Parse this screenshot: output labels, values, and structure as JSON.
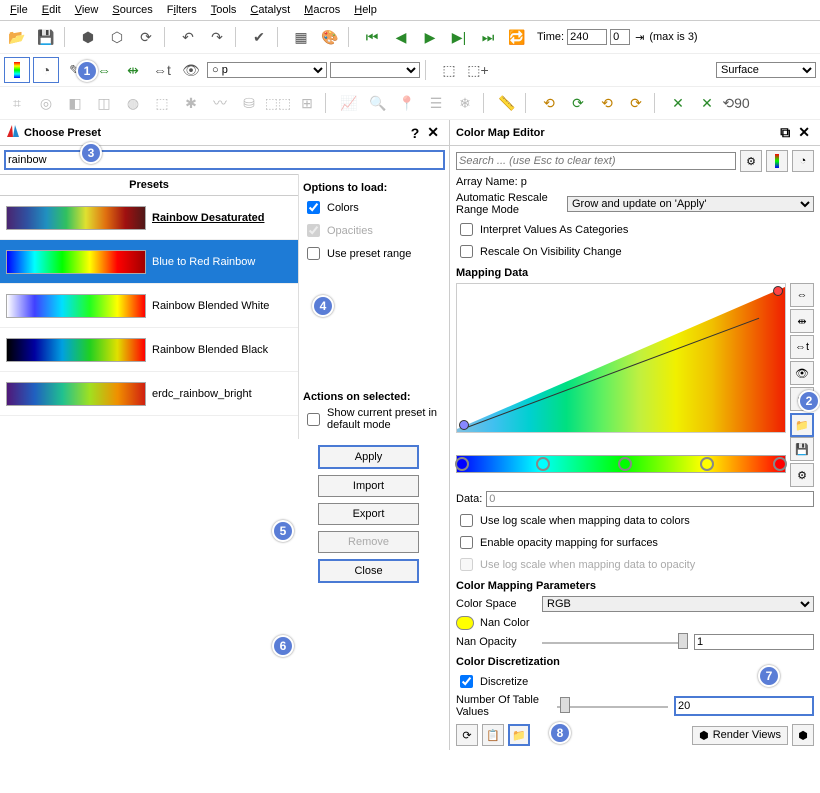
{
  "menu": [
    "File",
    "Edit",
    "View",
    "Sources",
    "Filters",
    "Tools",
    "Catalyst",
    "Macros",
    "Help"
  ],
  "time": {
    "label": "Time:",
    "value": "240",
    "step": "0",
    "max_text": "(max is 3)"
  },
  "array_combo": "○ p",
  "repr_combo": "Surface",
  "choose_preset": {
    "title": "Choose Preset",
    "search": "rainbow",
    "presets_header": "Presets",
    "items": [
      {
        "name": "Rainbow Desaturated",
        "bold": true,
        "grad": "linear-gradient(to right,#4a2570,#3050a0,#2090c0,#30c060,#e0e030,#e07010,#a01010,#501818)"
      },
      {
        "name": "Blue to Red Rainbow",
        "bold": false,
        "grad": "linear-gradient(to right,#0000ff,#00ffff,#00ff00,#ffff00,#ff0000,#a00000)",
        "selected": true
      },
      {
        "name": "Rainbow Blended White",
        "bold": false,
        "grad": "linear-gradient(to right,#ffffff,#4040ff,#00e0ff,#20ff20,#ffff00,#ff0000)"
      },
      {
        "name": "Rainbow Blended Black",
        "bold": false,
        "grad": "linear-gradient(to right,#000000,#0000a0,#00a0e0,#20d020,#e0e000,#ff0000)"
      },
      {
        "name": "erdc_rainbow_bright",
        "bold": false,
        "grad": "linear-gradient(to right,#501878,#2060c0,#20c090,#a0e020,#f09000,#d02010)"
      }
    ],
    "opts_header": "Options to load:",
    "opt_colors": "Colors",
    "opt_opacities": "Opacities",
    "opt_range": "Use preset range",
    "actions_header": "Actions on selected:",
    "act_default": "Show current preset in default mode",
    "btn_apply": "Apply",
    "btn_import": "Import",
    "btn_export": "Export",
    "btn_remove": "Remove",
    "btn_close": "Close"
  },
  "cme": {
    "title": "Color Map Editor",
    "search_placeholder": "Search ... (use Esc to clear text)",
    "array_name_label": "Array Name: p",
    "rescale_label": "Automatic Rescale Range Mode",
    "rescale_value": "Grow and update on 'Apply'",
    "interpret_cat": "Interpret Values As Categories",
    "rescale_vis": "Rescale On Visibility Change",
    "mapping_data": "Mapping Data",
    "data_label": "Data:",
    "data_value": "0",
    "use_log_colors": "Use log scale when mapping data to colors",
    "enable_opacity": "Enable opacity mapping for surfaces",
    "use_log_opacity": "Use log scale when mapping data to opacity",
    "cmp_header": "Color Mapping Parameters",
    "color_space": "Color Space",
    "color_space_value": "RGB",
    "nan_color": "Nan Color",
    "nan_opacity": "Nan Opacity",
    "nan_opacity_value": "1",
    "discretization": "Color Discretization",
    "discretize": "Discretize",
    "num_values_label": "Number Of Table Values",
    "num_values": "20",
    "render_views": "Render Views"
  },
  "callouts": {
    "c1": "1",
    "c2": "2",
    "c3": "3",
    "c4": "4",
    "c5": "5",
    "c6": "6",
    "c7": "7",
    "c8": "8"
  }
}
